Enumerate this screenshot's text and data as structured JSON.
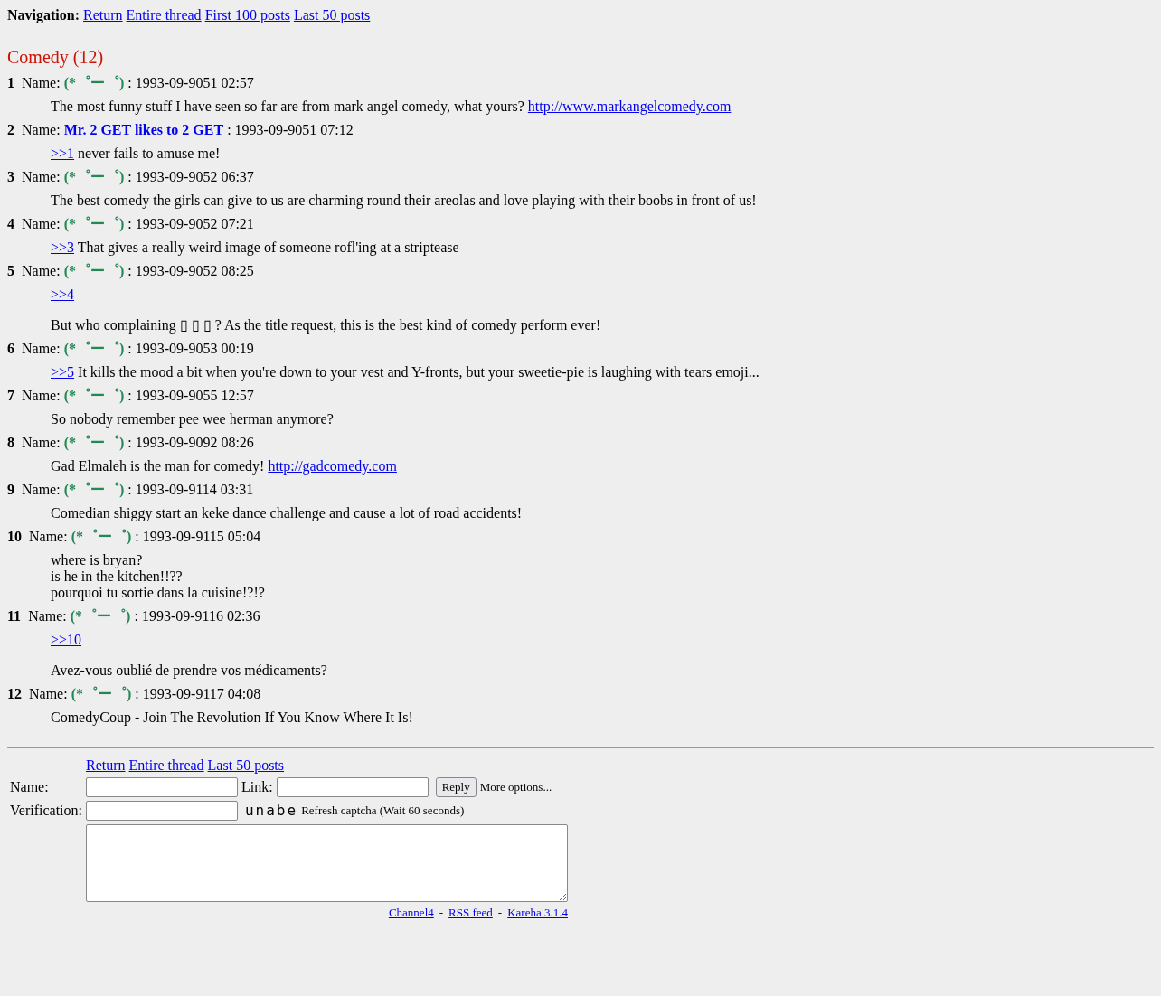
{
  "navigation": {
    "label": "Navigation:",
    "links": [
      "Return",
      "Entire thread",
      "First 100 posts",
      "Last 50 posts"
    ]
  },
  "thread": {
    "title": "Comedy (12)"
  },
  "posts": [
    {
      "number": "1",
      "label": "Name:",
      "name": {
        "kind": "trip",
        "text": "(*゜ー゜)"
      },
      "date": ": 1993-09-9051 02:57",
      "body": [
        [
          [
            {
              "kind": "text",
              "text": "The most funny stuff I have seen so far are from mark angel comedy, what yours? "
            },
            {
              "kind": "link",
              "text": "http://www.markangelcomedy.com"
            }
          ]
        ]
      ]
    },
    {
      "number": "2",
      "label": "Name:",
      "name": {
        "kind": "email",
        "text": "Mr. 2 GET likes to 2 GET"
      },
      "date": ": 1993-09-9051 07:12",
      "body": [
        [
          [
            {
              "kind": "link",
              "text": ">>1"
            },
            {
              "kind": "text",
              "text": " never fails to amuse me!"
            }
          ]
        ]
      ]
    },
    {
      "number": "3",
      "label": "Name:",
      "name": {
        "kind": "trip",
        "text": "(*゜ー゜)"
      },
      "date": ": 1993-09-9052 06:37",
      "body": [
        [
          [
            {
              "kind": "text",
              "text": "The best comedy the girls can give to us are charming round their areolas and love playing with their boobs in front of us!"
            }
          ]
        ]
      ]
    },
    {
      "number": "4",
      "label": "Name:",
      "name": {
        "kind": "trip",
        "text": "(*゜ー゜)"
      },
      "date": ": 1993-09-9052 07:21",
      "body": [
        [
          [
            {
              "kind": "link",
              "text": ">>3"
            },
            {
              "kind": "text",
              "text": " That gives a really weird image of someone rofl'ing at a striptease"
            }
          ]
        ]
      ]
    },
    {
      "number": "5",
      "label": "Name:",
      "name": {
        "kind": "trip",
        "text": "(*゜ー゜)"
      },
      "date": ": 1993-09-9052 08:25",
      "body": [
        [
          [
            {
              "kind": "link",
              "text": ">>4"
            }
          ]
        ],
        [
          [
            {
              "kind": "text",
              "text": "But who complaining ▯ ▯ ▯ ? As the title request, this is the best kind of comedy perform ever!"
            }
          ]
        ]
      ]
    },
    {
      "number": "6",
      "label": "Name:",
      "name": {
        "kind": "trip",
        "text": "(*゜ー゜)"
      },
      "date": ": 1993-09-9053 00:19",
      "body": [
        [
          [
            {
              "kind": "link",
              "text": ">>5"
            },
            {
              "kind": "text",
              "text": " It kills the mood a bit when you're down to your vest and Y-fronts, but your sweetie-pie is laughing with tears emoji..."
            }
          ]
        ]
      ]
    },
    {
      "number": "7",
      "label": "Name:",
      "name": {
        "kind": "trip",
        "text": "(*゜ー゜)"
      },
      "date": ": 1993-09-9055 12:57",
      "body": [
        [
          [
            {
              "kind": "text",
              "text": "So nobody remember pee wee herman anymore?"
            }
          ]
        ]
      ]
    },
    {
      "number": "8",
      "label": "Name:",
      "name": {
        "kind": "trip",
        "text": "(*゜ー゜)"
      },
      "date": ": 1993-09-9092 08:26",
      "body": [
        [
          [
            {
              "kind": "text",
              "text": "Gad Elmaleh is the man for comedy! "
            },
            {
              "kind": "link",
              "text": "http://gadcomedy.com"
            }
          ]
        ]
      ]
    },
    {
      "number": "9",
      "label": "Name:",
      "name": {
        "kind": "trip",
        "text": "(*゜ー゜)"
      },
      "date": ": 1993-09-9114 03:31",
      "body": [
        [
          [
            {
              "kind": "text",
              "text": "Comedian shiggy start an keke dance challenge and cause a lot of road accidents!"
            }
          ]
        ]
      ]
    },
    {
      "number": "10",
      "label": "Name:",
      "name": {
        "kind": "trip",
        "text": "(*゜ー゜)"
      },
      "date": ": 1993-09-9115 05:04",
      "body": [
        [
          [
            {
              "kind": "text",
              "text": "where is bryan?"
            }
          ],
          [
            {
              "kind": "text",
              "text": "is he in the kitchen!!??"
            }
          ],
          [
            {
              "kind": "text",
              "text": "pourquoi tu sortie dans la cuisine!?!?"
            }
          ]
        ]
      ]
    },
    {
      "number": "11",
      "label": "Name:",
      "name": {
        "kind": "trip",
        "text": "(*゜ー゜)"
      },
      "date": ": 1993-09-9116 02:36",
      "body": [
        [
          [
            {
              "kind": "link",
              "text": ">>10"
            }
          ]
        ],
        [
          [
            {
              "kind": "text",
              "text": "Avez-vous oublié de prendre vos médicaments?"
            }
          ]
        ]
      ]
    },
    {
      "number": "12",
      "label": "Name:",
      "name": {
        "kind": "trip",
        "text": "(*゜ー゜)"
      },
      "date": ": 1993-09-9117 04:08",
      "body": [
        [
          [
            {
              "kind": "text",
              "text": "ComedyCoup - Join The Revolution If You Know Where It Is!"
            }
          ]
        ]
      ]
    }
  ],
  "reply_form": {
    "links": [
      "Return",
      "Entire thread",
      "Last 50 posts"
    ],
    "name_label": "Name:",
    "link_label": "Link:",
    "submit": "Reply",
    "more_options": "More options...",
    "verification_label": "Verification:",
    "captcha": "unabe",
    "refresh": "Refresh captcha (Wait 60 seconds)"
  },
  "footer": {
    "links": [
      "Channel4",
      "RSS feed",
      "Kareha 3.1.4"
    ],
    "separator": "-"
  }
}
